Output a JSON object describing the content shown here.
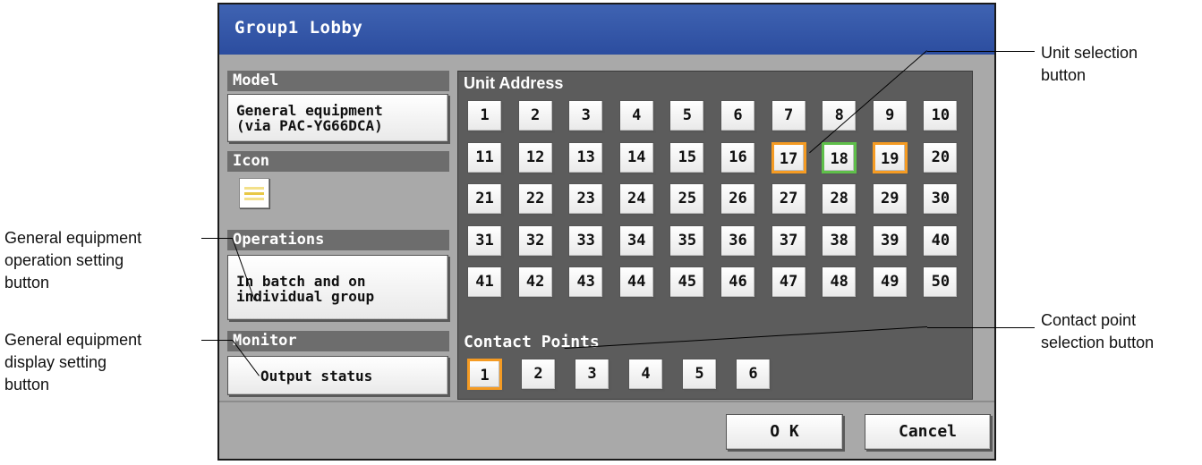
{
  "window": {
    "title": "Group1 Lobby"
  },
  "left_panel": {
    "model_label": "Model",
    "model_button": "General equipment\n(via PAC-YG66DCA)",
    "icon_label": "Icon",
    "icon_name": "equipment-icon",
    "operations_label": "Operations",
    "operations_button": "In batch and on\nindividual group",
    "monitor_label": "Monitor",
    "monitor_button": "Output status"
  },
  "unit_address": {
    "label": "Unit Address",
    "units": [
      {
        "label": "1"
      },
      {
        "label": "2"
      },
      {
        "label": "3"
      },
      {
        "label": "4"
      },
      {
        "label": "5"
      },
      {
        "label": "6"
      },
      {
        "label": "7"
      },
      {
        "label": "8"
      },
      {
        "label": "9"
      },
      {
        "label": "10"
      },
      {
        "label": "11"
      },
      {
        "label": "12"
      },
      {
        "label": "13"
      },
      {
        "label": "14"
      },
      {
        "label": "15"
      },
      {
        "label": "16"
      },
      {
        "label": "17",
        "state": "selected-orange"
      },
      {
        "label": "18",
        "state": "selected-green"
      },
      {
        "label": "19",
        "state": "selected-orange"
      },
      {
        "label": "20"
      },
      {
        "label": "21"
      },
      {
        "label": "22"
      },
      {
        "label": "23"
      },
      {
        "label": "24"
      },
      {
        "label": "25"
      },
      {
        "label": "26"
      },
      {
        "label": "27"
      },
      {
        "label": "28"
      },
      {
        "label": "29"
      },
      {
        "label": "30"
      },
      {
        "label": "31"
      },
      {
        "label": "32"
      },
      {
        "label": "33"
      },
      {
        "label": "34"
      },
      {
        "label": "35"
      },
      {
        "label": "36"
      },
      {
        "label": "37"
      },
      {
        "label": "38"
      },
      {
        "label": "39"
      },
      {
        "label": "40"
      },
      {
        "label": "41"
      },
      {
        "label": "42"
      },
      {
        "label": "43"
      },
      {
        "label": "44"
      },
      {
        "label": "45"
      },
      {
        "label": "46"
      },
      {
        "label": "47"
      },
      {
        "label": "48"
      },
      {
        "label": "49"
      },
      {
        "label": "50"
      }
    ]
  },
  "contact_points": {
    "label": "Contact Points",
    "points": [
      {
        "label": "1",
        "state": "selected-orange"
      },
      {
        "label": "2"
      },
      {
        "label": "3"
      },
      {
        "label": "4"
      },
      {
        "label": "5"
      },
      {
        "label": "6"
      }
    ]
  },
  "footer": {
    "ok_label": "O K",
    "cancel_label": "Cancel"
  },
  "annotations": {
    "unit_selection": "Unit selection\nbutton",
    "operation_setting": "General equipment\noperation setting\nbutton",
    "display_setting": "General equipment\ndisplay setting\nbutton",
    "contact_point": "Contact point\nselection button"
  },
  "colors": {
    "title_bar": "#3a5db0",
    "selected_orange": "#f59b23",
    "selected_green": "#5fbf4a"
  }
}
